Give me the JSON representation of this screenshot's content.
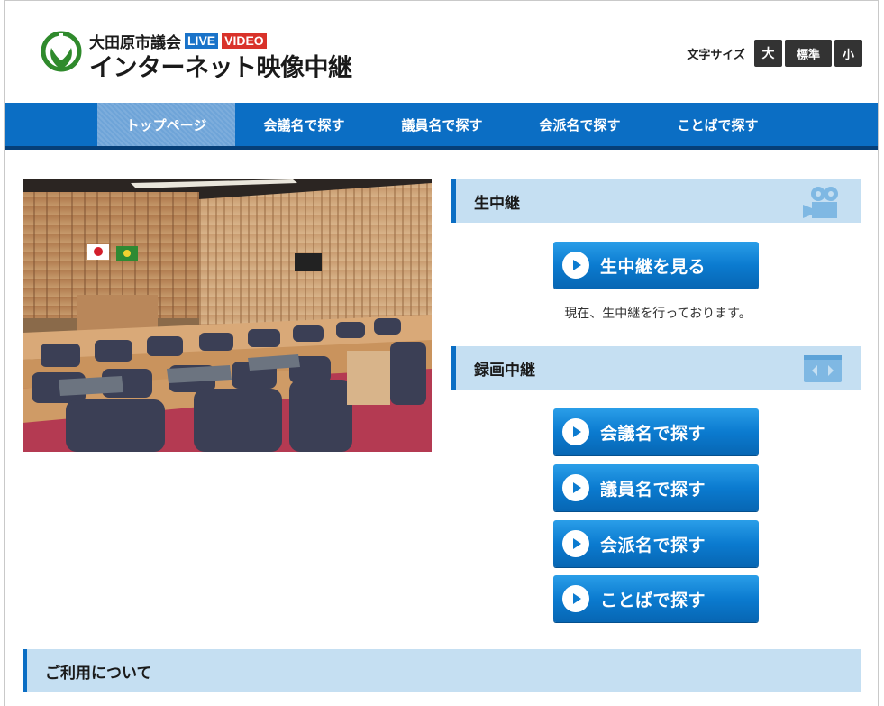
{
  "header": {
    "org_name": "大田原市議会",
    "badge_live": "LIVE",
    "badge_video": "VIDEO",
    "site_title": "インターネット映像中継",
    "font_size": {
      "label": "文字サイズ",
      "large": "大",
      "standard": "標準",
      "small": "小"
    }
  },
  "nav": {
    "items": [
      {
        "label": "トップページ",
        "active": true
      },
      {
        "label": "会議名で探す"
      },
      {
        "label": "議員名で探す"
      },
      {
        "label": "会派名で探す"
      },
      {
        "label": "ことばで探す"
      }
    ]
  },
  "photo": {
    "subject": "council chamber"
  },
  "live_section": {
    "title": "生中継",
    "icon": "video-camera-icon",
    "button_label": "生中継を見る",
    "status": "現在、生中継を行っております。"
  },
  "recorded_section": {
    "title": "録画中継",
    "icon": "video-tape-icon",
    "buttons": [
      {
        "label": "会議名で探す"
      },
      {
        "label": "議員名で探す"
      },
      {
        "label": "会派名で探す"
      },
      {
        "label": "ことばで探す"
      }
    ]
  },
  "info_section": {
    "title": "ご利用について"
  },
  "colors": {
    "primary_blue": "#0b6ec4",
    "nav_dark": "#063f78",
    "section_bg": "#c5dff2",
    "badge_live": "#1a73c9",
    "badge_video": "#d9322a",
    "logo_green": "#2f8a2c"
  }
}
